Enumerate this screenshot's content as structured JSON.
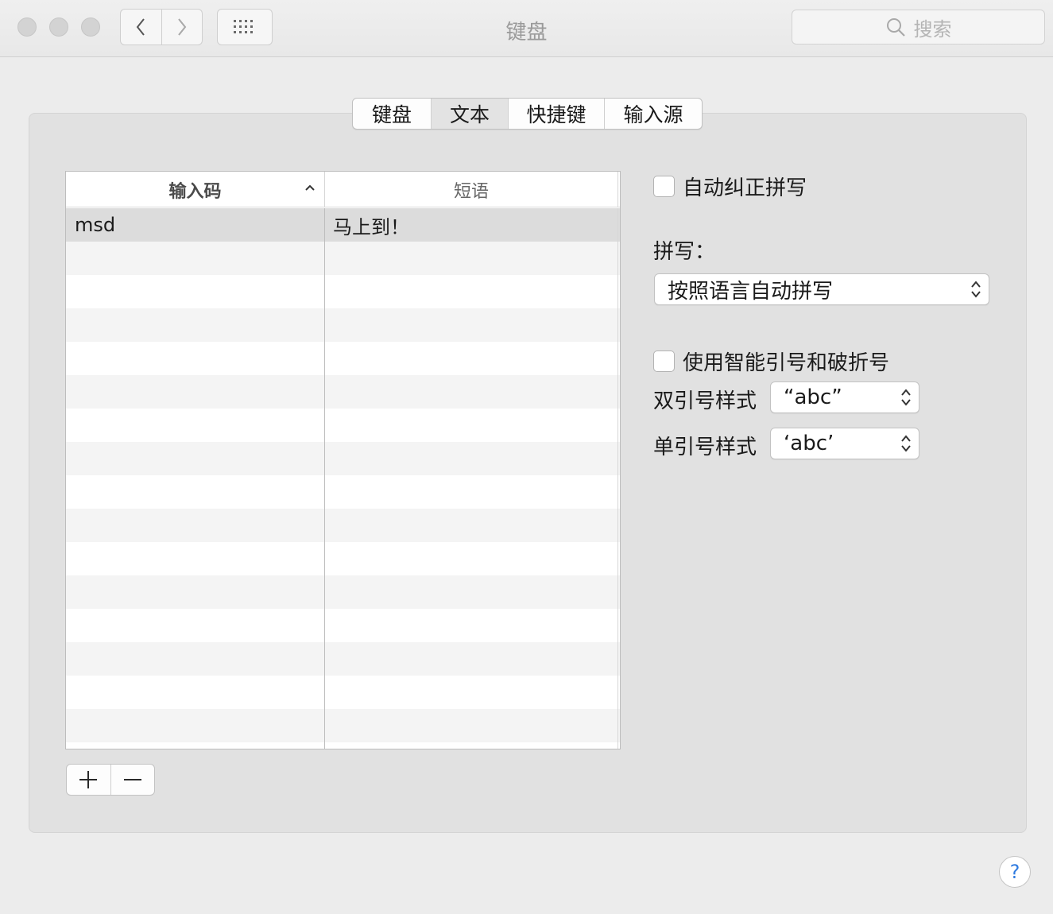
{
  "window": {
    "title": "键盘"
  },
  "toolbar": {
    "back_icon": "chevron-left-icon",
    "forward_icon": "chevron-right-icon",
    "show_all_icon": "grid-icon",
    "search": {
      "placeholder": "搜索",
      "icon": "search-icon"
    }
  },
  "tabs": [
    {
      "label": "键盘",
      "selected": false
    },
    {
      "label": "文本",
      "selected": true
    },
    {
      "label": "快捷键",
      "selected": false
    },
    {
      "label": "输入源",
      "selected": false
    }
  ],
  "table": {
    "columns": [
      {
        "label": "输入码",
        "sorted": "ascending"
      },
      {
        "label": "短语"
      }
    ],
    "rows": [
      {
        "code": "msd",
        "phrase": "马上到！",
        "selected": true
      }
    ]
  },
  "list_buttons": {
    "add_icon": "plus-icon",
    "remove_icon": "minus-icon"
  },
  "options": {
    "autocorrect": {
      "label": "自动纠正拼写",
      "checked": false
    },
    "spelling": {
      "label": "拼写：",
      "value": "按照语言自动拼写"
    },
    "smart_quotes": {
      "label": "使用智能引号和破折号",
      "checked": false
    },
    "double_quotes": {
      "label": "双引号样式",
      "value": "“abc”"
    },
    "single_quotes": {
      "label": "单引号样式",
      "value": "‘abc’"
    }
  },
  "help": {
    "label": "?"
  },
  "colors": {
    "accent": "#2f7be0",
    "panel": "#e1e1e1",
    "window": "#ececec"
  }
}
